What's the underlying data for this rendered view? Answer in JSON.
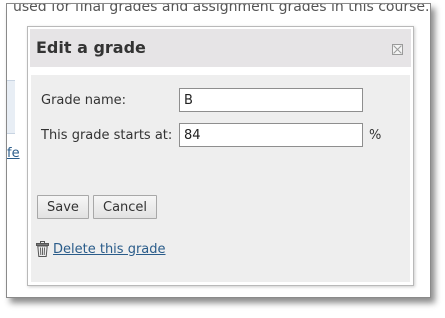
{
  "background": {
    "top_text": "used for final grades and assignment grades in this course.",
    "left_link_fragment": "fe"
  },
  "dialog": {
    "title": "Edit a grade",
    "fields": {
      "grade_name_label": "Grade name:",
      "grade_name_value": "B",
      "starts_at_label": "This grade starts at:",
      "starts_at_value": "84",
      "starts_at_unit": "%"
    },
    "buttons": {
      "save": "Save",
      "cancel": "Cancel"
    },
    "delete_link": "Delete this grade"
  },
  "colors": {
    "header_bg": "#e6e4e6",
    "body_bg": "#eeeeee",
    "link": "#2a5c8a"
  },
  "icons": [
    "close-icon",
    "trash-icon"
  ]
}
